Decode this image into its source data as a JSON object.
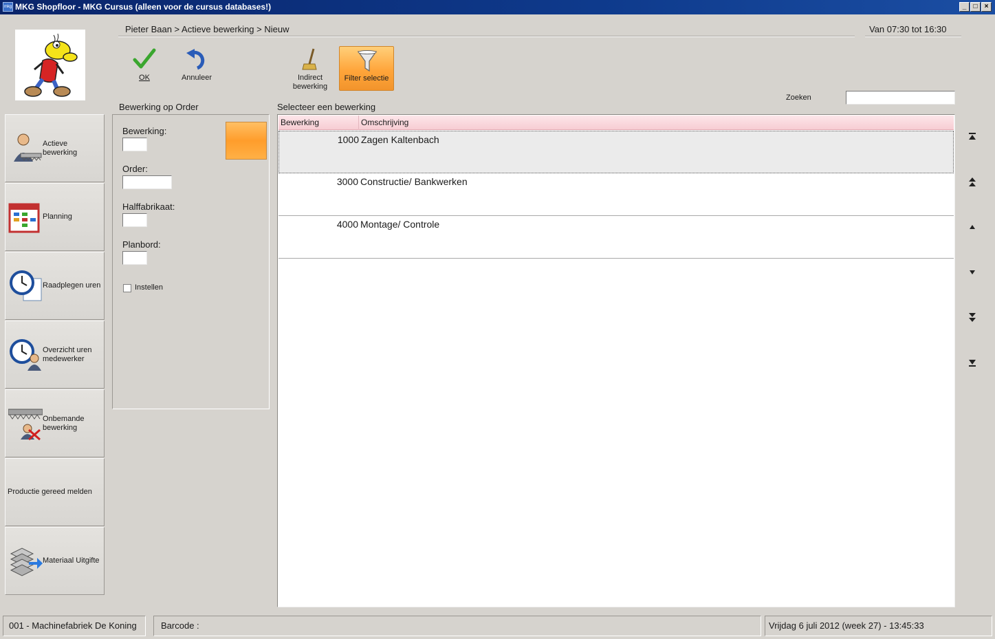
{
  "window": {
    "title": "MKG Shopfloor - MKG Cursus (alleen voor de cursus databases!)",
    "icon_text": "mkg"
  },
  "breadcrumb": "Pieter Baan > Actieve bewerking > Nieuw",
  "shift": "Van 07:30 tot 16:30",
  "toolbar": {
    "ok_label": "OK",
    "annuleer_label": "Annuleer",
    "indirect_label_1": "Indirect",
    "indirect_label_2": "bewerking",
    "filter_label": "Filter selectie"
  },
  "search": {
    "label": "Zoeken",
    "value": ""
  },
  "nav": {
    "items": [
      {
        "label": "Actieve bewerking",
        "icon": "worker-saw-icon"
      },
      {
        "label": "Planning",
        "icon": "calendar-icon"
      },
      {
        "label": "Raadplegen uren",
        "icon": "clock-document-icon"
      },
      {
        "label": "Overzicht uren medewerker",
        "icon": "clock-worker-icon"
      },
      {
        "label": "Onbemande bewerking",
        "icon": "unmanned-saw-icon"
      },
      {
        "label": "Productie gereed melden",
        "icon": ""
      },
      {
        "label": "Materiaal Uitgifte",
        "icon": "material-rack-icon"
      }
    ]
  },
  "form": {
    "title": "Bewerking op Order",
    "bewerking_label": "Bewerking:",
    "bewerking_value": "",
    "order_label": "Order:",
    "order_value": "",
    "halffabrikaat_label": "Halffabrikaat:",
    "halffabrikaat_value": "",
    "planbord_label": "Planbord:",
    "planbord_value": "",
    "instellen_label": "Instellen",
    "instellen_checked": false
  },
  "grid": {
    "title": "Selecteer een bewerking",
    "columns": [
      "Bewerking",
      "Omschrijving"
    ],
    "rows": [
      {
        "code": "1000",
        "desc": "Zagen Kaltenbach",
        "selected": true
      },
      {
        "code": "3000",
        "desc": "Constructie/ Bankwerken",
        "selected": false
      },
      {
        "code": "4000",
        "desc": "Montage/ Controle",
        "selected": false
      }
    ]
  },
  "status": {
    "company": "001 - Machinefabriek De Koning",
    "barcode_label": "Barcode :",
    "datetime": "Vrijdag 6 juli 2012 (week 27)  -  13:45:33"
  },
  "colors": {
    "titlebar": "#0a246a",
    "accent_orange": "#ffa53a",
    "grid_header": "#f7cdd3",
    "ok_green": "#3aa62e",
    "undo_blue": "#2a5cb8"
  }
}
